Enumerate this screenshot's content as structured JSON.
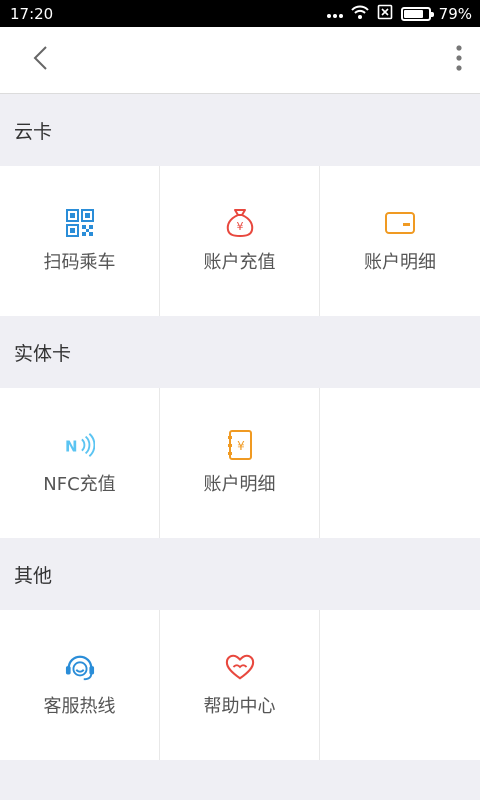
{
  "status": {
    "time": "17:20",
    "battery_percent": "79%",
    "battery_level": 0.79
  },
  "navbar": {
    "back_icon": "chevron-left-icon",
    "more_icon": "more-vertical-icon"
  },
  "sections": [
    {
      "title": "云卡",
      "items": [
        {
          "label": "扫码乘车",
          "icon": "qrcode-icon",
          "color": "#2a8dd8"
        },
        {
          "label": "账户充值",
          "icon": "money-bag-icon",
          "color": "#e8483e"
        },
        {
          "label": "账户明细",
          "icon": "card-icon",
          "color": "#f09a22"
        }
      ]
    },
    {
      "title": "实体卡",
      "items": [
        {
          "label": "NFC充值",
          "icon": "nfc-icon",
          "color": "#5bc4f2"
        },
        {
          "label": "账户明细",
          "icon": "receipt-icon",
          "color": "#f09a22"
        },
        {
          "label": "",
          "icon": "",
          "color": ""
        }
      ]
    },
    {
      "title": "其他",
      "items": [
        {
          "label": "客服热线",
          "icon": "headset-icon",
          "color": "#2a8dd8"
        },
        {
          "label": "帮助中心",
          "icon": "heart-hands-icon",
          "color": "#e8483e"
        },
        {
          "label": "",
          "icon": "",
          "color": ""
        }
      ]
    }
  ]
}
